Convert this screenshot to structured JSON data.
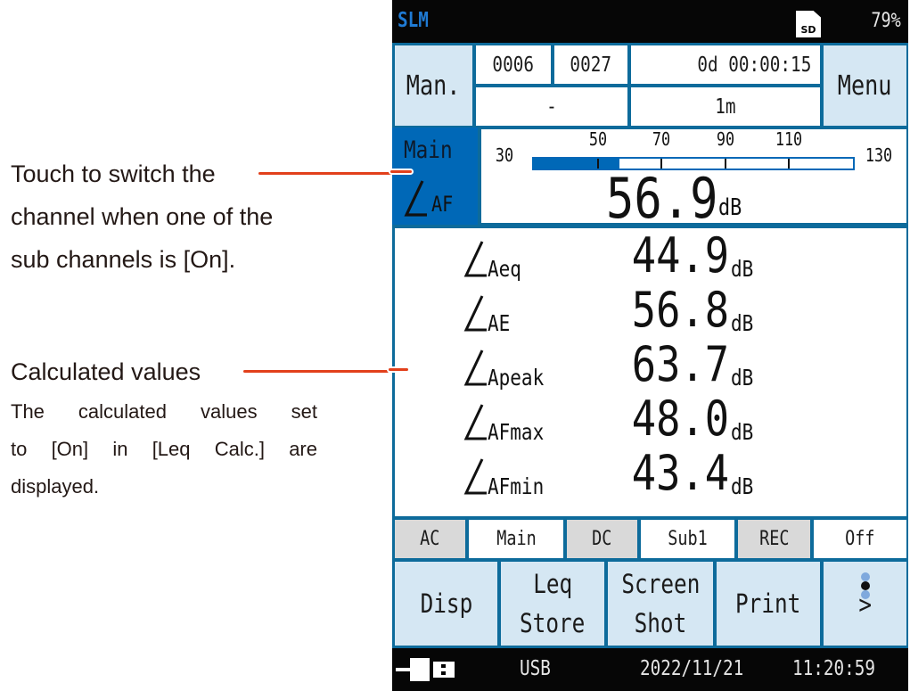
{
  "annotations": {
    "channel_switch": {
      "lines": [
        "Touch to switch the",
        "channel when one of the",
        "sub channels is [On]."
      ]
    },
    "calculated": {
      "title": "Calculated values",
      "body_lines": [
        "The calculated values set",
        "to [On] in [Leq Calc.] are",
        "displayed."
      ]
    }
  },
  "header": {
    "app_name": "SLM",
    "sd_label": "SD",
    "battery": "79%"
  },
  "top": {
    "mode_button": "Man.",
    "count_1": "0006",
    "count_2": "0027",
    "elapsed": "0d 00:00:15",
    "field_left": "-",
    "field_right": "1m",
    "menu_button": "Menu"
  },
  "level": {
    "channel": "Main",
    "symbol": "L",
    "subscript": "AF",
    "value": "56.9",
    "unit": "dB",
    "bar_value": 56.9,
    "scale": {
      "min": 30,
      "max": 130,
      "min_label": "30",
      "max_label": "130",
      "ticks": [
        50,
        70,
        90,
        110
      ],
      "tick_labels": [
        "50",
        "70",
        "90",
        "110"
      ]
    }
  },
  "calc": [
    {
      "symbol": "L",
      "sub": "Aeq",
      "value": "44.9",
      "unit": "dB"
    },
    {
      "symbol": "L",
      "sub": "AE",
      "value": "56.8",
      "unit": "dB"
    },
    {
      "symbol": "L",
      "sub": "Apeak",
      "value": "63.7",
      "unit": "dB"
    },
    {
      "symbol": "L",
      "sub": "AFmax",
      "value": "48.0",
      "unit": "dB"
    },
    {
      "symbol": "L",
      "sub": "AFmin",
      "value": "43.4",
      "unit": "dB"
    }
  ],
  "status": [
    {
      "label": "AC",
      "value": "Main"
    },
    {
      "label": "DC",
      "value": "Sub1"
    },
    {
      "label": "REC",
      "value": "Off"
    }
  ],
  "buttons": [
    {
      "lines": [
        "Disp"
      ]
    },
    {
      "lines": [
        "Leq",
        "Store"
      ]
    },
    {
      "lines": [
        "Screen",
        "Shot"
      ]
    },
    {
      "lines": [
        "Print"
      ]
    },
    {
      "lines": [
        ">"
      ],
      "page_indicator": {
        "pages": 3,
        "current": 2
      }
    }
  ],
  "footer": {
    "connection": "USB",
    "date": "2022/11/21",
    "time": "11:20:59"
  },
  "colors": {
    "frame_blue": "#0d6b9b",
    "accent_blue": "#0068b7",
    "light_cell": "#d5e7f3",
    "gray_cell": "#d9d9d9",
    "leader_red": "#e2401b",
    "dot_inactive": "#7fa9dd",
    "dot_active": "#111111"
  }
}
